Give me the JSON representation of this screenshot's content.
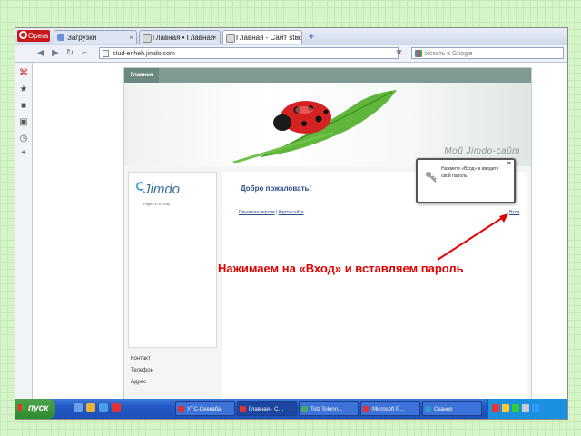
{
  "browser": {
    "menu_label": "Opera",
    "tabs": [
      {
        "label": "Загрузки",
        "active": false
      },
      {
        "label": "Главная • Главная",
        "active": false
      },
      {
        "label": "Главная - Сайт stud…",
        "active": true
      }
    ],
    "new_tab_label": "+",
    "nav": {
      "back": "◀",
      "forward": "▶",
      "reload": "↻",
      "key": "⌐"
    },
    "url": "stud-eriheh.jimdo.com",
    "search_placeholder": "Искать в Google"
  },
  "side_panel": {
    "icons": [
      "opera-icon",
      "bookmarks-icon",
      "notes-icon",
      "downloads-icon",
      "history-icon",
      "add-panel-icon"
    ]
  },
  "site": {
    "nav_item": "Главная",
    "title": "Мой Jimdo-сайт",
    "welcome": "Добро пожаловать!",
    "links": [
      "Печатная версия",
      "Карта сайта"
    ],
    "login_label": "Вход",
    "logo": {
      "name": "Jimdo",
      "tagline": "Pages in a Snap"
    },
    "contact": {
      "heading": "Контакт",
      "phone": "Телефон",
      "address": "Адрес"
    }
  },
  "tooltip": {
    "text": "Нажмите «Вход» и введите свой пароль.",
    "close": "×"
  },
  "annotation": {
    "text": "Нажимаем на «Вход» и вставляем пароль",
    "color": "#e00000"
  },
  "taskbar": {
    "start_label": "пуск",
    "tasks": [
      {
        "label": "УТС-Севкаба",
        "color": "#d33"
      },
      {
        "label": "Главная - С…",
        "color": "#d33"
      },
      {
        "label": "Tolz Tolenn…",
        "color": "#4a6"
      },
      {
        "label": "Microsoft P…",
        "color": "#d33"
      },
      {
        "label": "Сканер",
        "color": "#39c"
      }
    ],
    "clock": ""
  },
  "colors": {
    "background": "#d5f5c8",
    "accent": "#2b4d8a",
    "site_nav": "#7f9a93"
  }
}
